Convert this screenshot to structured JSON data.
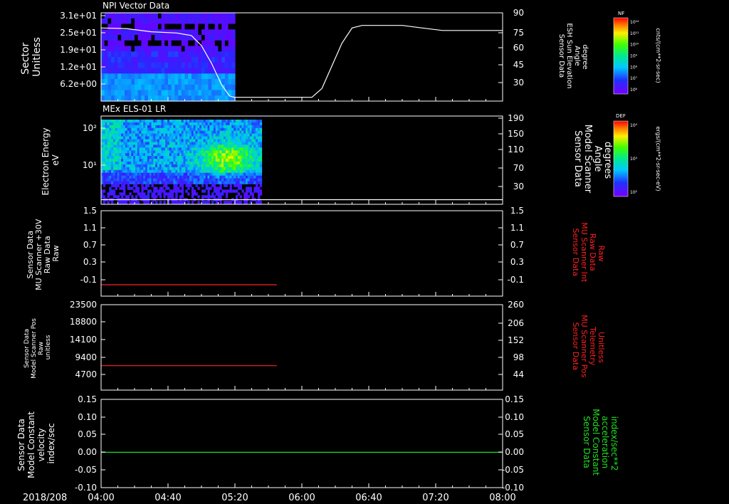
{
  "time_axis": {
    "date_label": "2018/208",
    "ticks": [
      "04:00",
      "04:40",
      "05:20",
      "06:00",
      "06:40",
      "07:20",
      "08:00"
    ],
    "range_hours": [
      4.0,
      8.0
    ]
  },
  "panels": [
    {
      "id": "npi",
      "title": "NPI Vector Data",
      "left_label": [
        "Sector",
        "Unitless"
      ],
      "left_ticks": [
        "3.1e+01",
        "2.5e+01",
        "1.9e+01",
        "1.2e+01",
        "6.2e+00"
      ],
      "right_label": [
        "Sensor Data",
        "ESH Sun Elevation",
        "Angle",
        "degree"
      ],
      "right_ticks": [
        "90",
        "75",
        "60",
        "45",
        "30"
      ],
      "right_color": "#ffffff"
    },
    {
      "id": "els",
      "title": "MEx ELS-01 LR",
      "left_label": [
        "Electron Energy",
        "eV"
      ],
      "left_ticks": [
        "10²",
        "10¹"
      ],
      "right_label": [
        "Sensor Data",
        "Model Scanner",
        "Angle",
        "degrees"
      ],
      "right_ticks": [
        "190",
        "150",
        "110",
        "70",
        "30"
      ],
      "right_color": "#ffffff"
    },
    {
      "id": "scanner_raw",
      "title": "",
      "left_label": [
        "Sensor Data",
        "MU Scanner +30V",
        "Raw Data",
        "Raw"
      ],
      "left_ticks": [
        "1.5",
        "1.1",
        "0.7",
        "0.3",
        "-0.1"
      ],
      "right_label": [
        "Sensor Data",
        "MU Scanner Int",
        "Raw Data",
        "Raw"
      ],
      "right_ticks": [
        "1.5",
        "1.1",
        "0.7",
        "0.3",
        "-0.1"
      ],
      "right_color": "#ff2020"
    },
    {
      "id": "scanner_pos",
      "title": "",
      "left_label": [
        "Sensor Data",
        "Model Scanner Pos",
        "Raw",
        "unitless"
      ],
      "left_ticks": [
        "23500",
        "18800",
        "14100",
        "9400",
        "4700"
      ],
      "right_label": [
        "Sensor Data",
        "MU Scanner Pos",
        "Telemetry",
        "Unitless"
      ],
      "right_ticks": [
        "260",
        "206",
        "152",
        "98",
        "44"
      ],
      "right_color": "#ff2020"
    },
    {
      "id": "model_const",
      "title": "",
      "left_label": [
        "Sensor Data",
        "Model Constant",
        "velocity",
        "index/sec"
      ],
      "left_ticks": [
        "0.15",
        "0.10",
        "0.05",
        "0.00",
        "-0.05",
        "-0.10"
      ],
      "right_label": [
        "Sensor Data",
        "Model Constant",
        "acceleration",
        "index/sec**2"
      ],
      "right_ticks": [
        "0.15",
        "0.10",
        "0.05",
        "0.00",
        "-0.05",
        "-0.10"
      ],
      "right_color": "#20e020"
    }
  ],
  "colorbars": [
    {
      "id": "nf",
      "tag": "NF",
      "unit": "cnts/(cm**2-sr-sec)",
      "ticks": [
        "10¹²",
        "10¹¹",
        "10¹⁰",
        "10⁹",
        "10⁸",
        "10⁷",
        "10⁶"
      ]
    },
    {
      "id": "def",
      "tag": "DEF",
      "unit": "ergs/(cm**2-sr-sec-eV)",
      "ticks": [
        "10⁴",
        "10³",
        "10²"
      ]
    }
  ],
  "chart_data": [
    {
      "type": "heatmap",
      "panel": "npi",
      "title": "NPI Vector Data",
      "x_range": [
        4.0,
        8.0
      ],
      "data_x_range": [
        4.0,
        5.333
      ],
      "overlay_series": {
        "name": "ESH Sun Elevation Angle",
        "color": "#ffffff",
        "y_axis": "right",
        "ylim": [
          20,
          90
        ],
        "x": [
          4.0,
          4.25,
          4.5,
          4.75,
          4.9,
          5.0,
          5.1,
          5.2,
          5.28,
          5.33,
          5.5,
          5.8,
          6.1,
          6.2,
          6.3,
          6.4,
          6.5,
          6.6,
          6.7,
          7.0,
          7.2,
          7.4,
          8.0
        ],
        "y": [
          78,
          77.5,
          75,
          74,
          72,
          64,
          50,
          33,
          24,
          23,
          23,
          23,
          23,
          30,
          48,
          66,
          78,
          80,
          80,
          80,
          78,
          76,
          76
        ]
      }
    },
    {
      "type": "heatmap",
      "panel": "els",
      "title": "MEx ELS-01 LR",
      "x_range": [
        4.0,
        8.0
      ],
      "data_x_range": [
        4.0,
        5.6
      ],
      "overlay_series": {
        "name": "Model Scanner Angle",
        "color": "#ffffff",
        "y_axis": "right",
        "ylim": [
          0,
          190
        ],
        "x": [
          4.0,
          8.0
        ],
        "y": [
          10,
          10
        ]
      }
    },
    {
      "type": "line",
      "panel": "scanner_raw",
      "x_range": [
        4.0,
        8.0
      ],
      "ylim": [
        -0.3,
        1.5
      ],
      "series": [
        {
          "name": "MU Scanner Int Raw Data",
          "color": "#ff2020",
          "x": [
            4.0,
            5.75
          ],
          "y": [
            -0.06,
            -0.06
          ]
        }
      ]
    },
    {
      "type": "line",
      "panel": "scanner_pos",
      "x_range": [
        4.0,
        8.0
      ],
      "ylim": [
        2000,
        23500
      ],
      "series": [
        {
          "name": "MU Scanner Pos Telemetry",
          "color": "#ff2020",
          "x": [
            4.0,
            5.75
          ],
          "y": [
            8150,
            8150
          ]
        }
      ]
    },
    {
      "type": "line",
      "panel": "model_const",
      "x_range": [
        4.0,
        8.0
      ],
      "ylim": [
        -0.1,
        0.15
      ],
      "series": [
        {
          "name": "Model Constant acceleration",
          "color": "#20e020",
          "x": [
            4.0,
            8.0
          ],
          "y": [
            0.0,
            0.0
          ]
        }
      ]
    }
  ]
}
